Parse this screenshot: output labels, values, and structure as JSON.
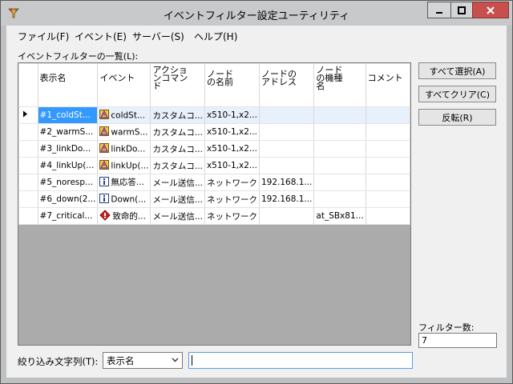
{
  "window": {
    "title": "イベントフィルター設定ユーティリティ"
  },
  "menu": [
    {
      "label": "ファイル(F)"
    },
    {
      "label": "イベント(E)"
    },
    {
      "label": "サーバー(S)"
    },
    {
      "label": "ヘルプ(H)"
    }
  ],
  "list_label": "イベントフィルターの一覧(L):",
  "columns": [
    "表示名",
    "イベント",
    "アクションコマンド",
    "ノードの名前",
    "ノードのアドレス",
    "ノードの機種名",
    "コメント"
  ],
  "columns_display": [
    [
      "表示名"
    ],
    [
      "イベント"
    ],
    [
      "アクショ",
      "ンコマン",
      "ド"
    ],
    [
      "ノード",
      "の名前"
    ],
    [
      "ノードの",
      "アドレス"
    ],
    [
      "ノード",
      "の機種",
      "名"
    ],
    [
      "コメント"
    ]
  ],
  "rows": [
    {
      "name": "#1_coldSt...",
      "event_icon": "warning-icon",
      "event": "coldSt...",
      "action": "カスタムコ...",
      "node_name": "x510-1,x2...",
      "node_address": "",
      "node_model": "",
      "comment": ""
    },
    {
      "name": "#2_warmS...",
      "event_icon": "warning-icon",
      "event": "warmS...",
      "action": "カスタムコ...",
      "node_name": "x510-1,x2...",
      "node_address": "",
      "node_model": "",
      "comment": ""
    },
    {
      "name": "#3_linkDo...",
      "event_icon": "warning-icon",
      "event": "linkDo...",
      "action": "カスタムコ...",
      "node_name": "x510-1,x2...",
      "node_address": "",
      "node_model": "",
      "comment": ""
    },
    {
      "name": "#4_linkUp(...",
      "event_icon": "warning-icon",
      "event": "linkUp(...",
      "action": "カスタムコ...",
      "node_name": "x510-1,x2...",
      "node_address": "",
      "node_model": "",
      "comment": ""
    },
    {
      "name": "#5_noresp...",
      "event_icon": "info-icon",
      "event": "無応答...",
      "action": "メール送信...",
      "node_name": "ネットワーク",
      "node_address": "192.168.1...",
      "node_model": "",
      "comment": ""
    },
    {
      "name": "#6_down(2...",
      "event_icon": "info-icon",
      "event": "Down(...",
      "action": "メール送信...",
      "node_name": "ネットワーク",
      "node_address": "192.168.1...",
      "node_model": "",
      "comment": ""
    },
    {
      "name": "#7_critical...",
      "event_icon": "critical-icon",
      "event": "致命的...",
      "action": "メール送信...",
      "node_name": "ネットワーク",
      "node_address": "",
      "node_model": "at_SBx81...",
      "comment": ""
    }
  ],
  "buttons": {
    "select_all": "すべて選択(A)",
    "clear_all": "すべてクリア(C)",
    "invert": "反転(R)"
  },
  "filter_count": {
    "label": "フィルター数:",
    "value": "7"
  },
  "filter": {
    "label": "絞り込み文字列(T):",
    "selected": "表示名",
    "text": ""
  }
}
